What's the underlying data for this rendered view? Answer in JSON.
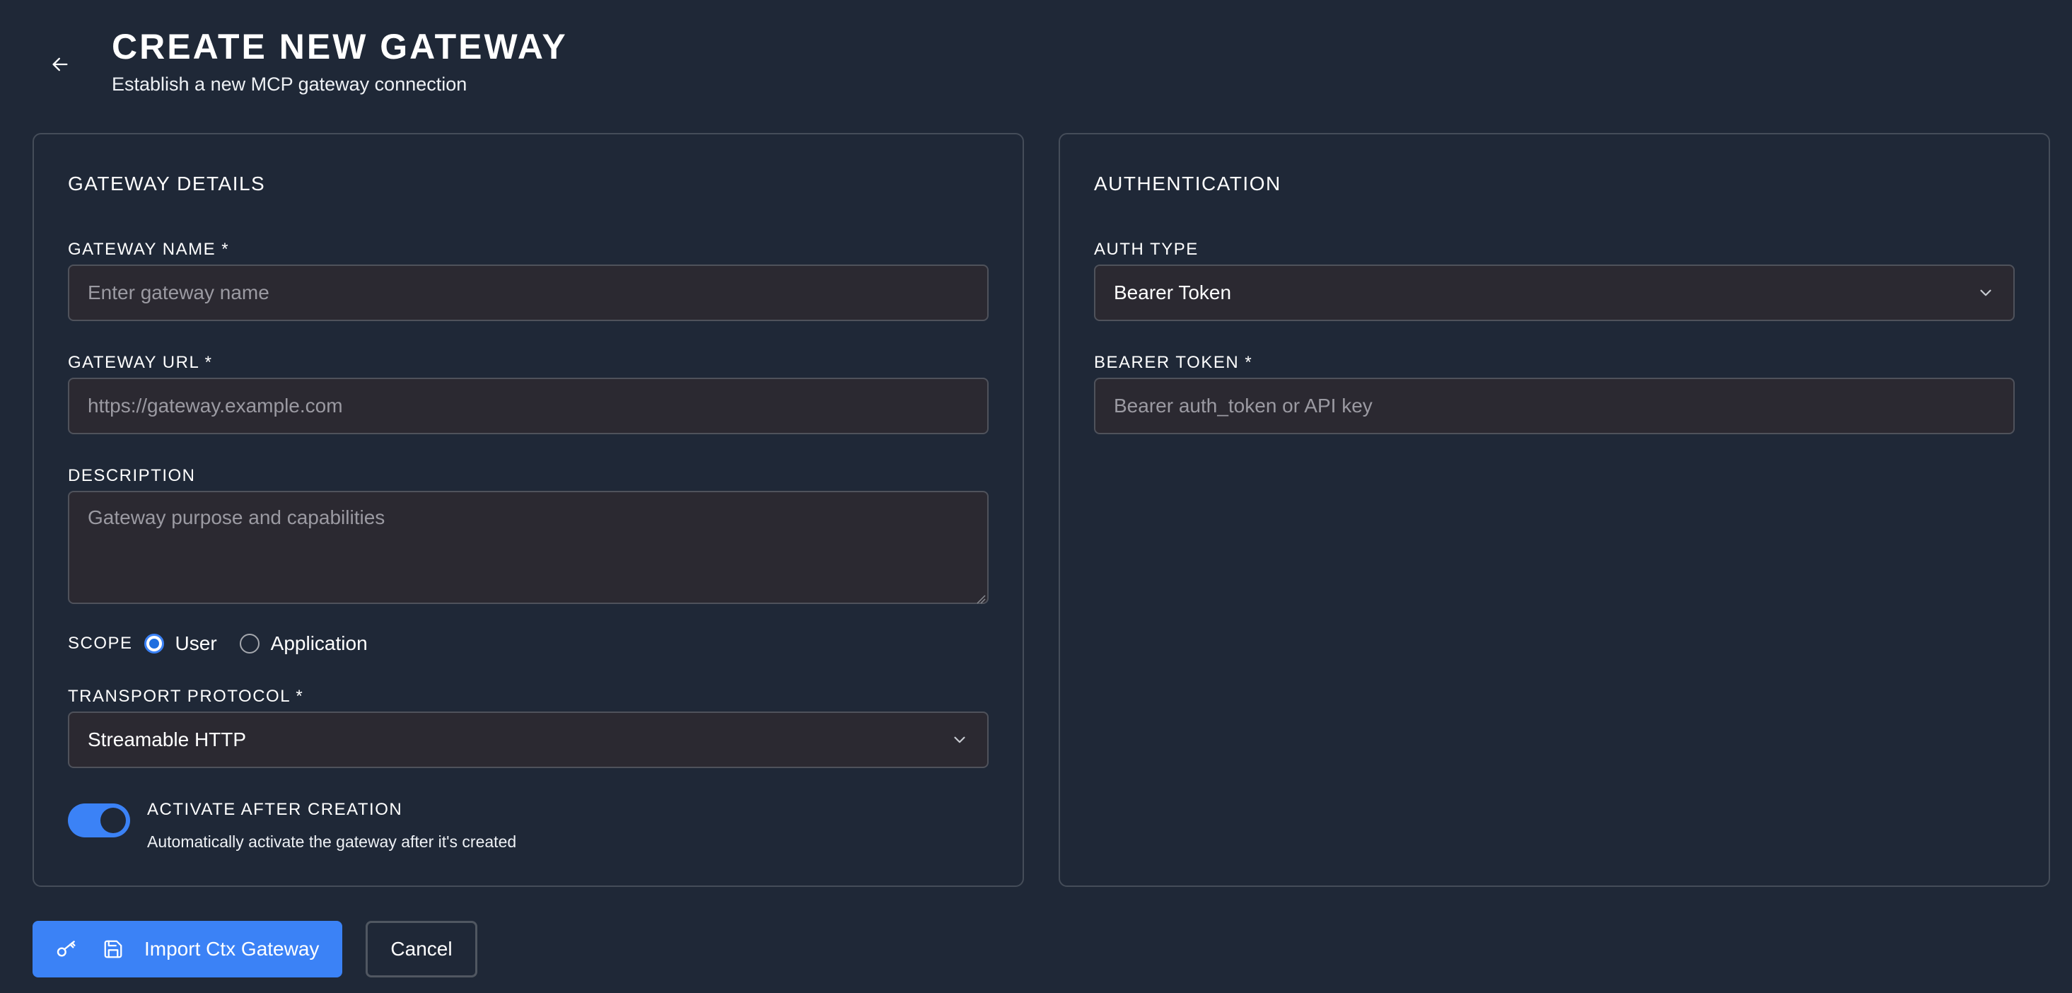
{
  "header": {
    "title": "CREATE NEW GATEWAY",
    "subtitle": "Establish a new MCP gateway connection"
  },
  "gateway_details": {
    "title": "GATEWAY DETAILS",
    "name": {
      "label": "GATEWAY NAME *",
      "placeholder": "Enter gateway name",
      "value": ""
    },
    "url": {
      "label": "GATEWAY URL *",
      "placeholder": "https://gateway.example.com",
      "value": ""
    },
    "description": {
      "label": "DESCRIPTION",
      "placeholder": "Gateway purpose and capabilities",
      "value": ""
    },
    "scope": {
      "label": "SCOPE",
      "options": [
        "User",
        "Application"
      ],
      "selected": "User"
    },
    "transport": {
      "label": "TRANSPORT PROTOCOL *",
      "value": "Streamable HTTP"
    },
    "activate": {
      "title": "ACTIVATE AFTER CREATION",
      "description": "Automatically activate the gateway after it's created",
      "enabled": true
    }
  },
  "authentication": {
    "title": "AUTHENTICATION",
    "auth_type": {
      "label": "AUTH TYPE",
      "value": "Bearer Token"
    },
    "bearer_token": {
      "label": "BEARER TOKEN *",
      "placeholder": "Bearer auth_token or API key",
      "value": ""
    }
  },
  "footer": {
    "primary_label": "Import Ctx Gateway",
    "cancel_label": "Cancel"
  },
  "icons": {
    "back": "arrow-left-icon",
    "key": "key-icon",
    "save": "save-icon",
    "chevron": "chevron-down-icon"
  },
  "colors": {
    "background": "#1f2837",
    "accent": "#3b82f6",
    "input_bg": "#2b2931",
    "border": "#454d59"
  }
}
